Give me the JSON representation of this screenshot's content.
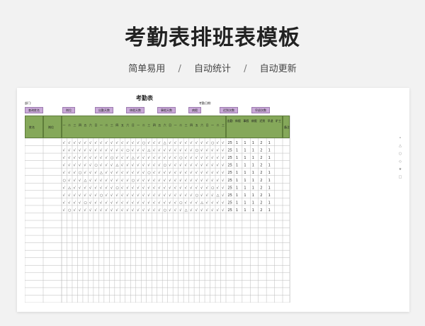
{
  "page": {
    "title": "考勤表排班表模板",
    "features": [
      "简单易用",
      "自动统计",
      "自动更新"
    ],
    "separator": "/"
  },
  "sheet": {
    "title": "考勤表",
    "dept_label": "部门:",
    "date_label": "考勤日期:",
    "summary_pills": [
      "查询姓名",
      "岗位",
      "出勤天数",
      "休假天数",
      "事假天数",
      "病假",
      "迟到次数",
      "早退次数"
    ],
    "col_name": "姓名",
    "col_post": "岗位",
    "col_remark": "备注",
    "day_headers": [
      "一",
      "二",
      "三",
      "四",
      "五",
      "六",
      "日",
      "一",
      "二",
      "三",
      "四",
      "五",
      "六",
      "日",
      "一",
      "二",
      "三",
      "四",
      "五",
      "六",
      "日",
      "一",
      "二",
      "三",
      "四",
      "五",
      "六",
      "日",
      "一",
      "二",
      "三"
    ],
    "stat_headers": [
      "出勤",
      "休假",
      "事假",
      "病假",
      "迟到",
      "早退",
      "旷工"
    ],
    "stat_values": [
      "25",
      "1",
      "1",
      "1",
      "2",
      "1"
    ],
    "rows_filled": 10,
    "rows_total": 22
  },
  "side_icons": [
    "dot-icon",
    "triangle-icon",
    "circle-icon",
    "diamond-icon",
    "star-icon",
    "square-icon"
  ],
  "colors": {
    "header_green": "#85a85a",
    "pill_purple": "#c9a9d8",
    "background": "#f2f2f2"
  }
}
